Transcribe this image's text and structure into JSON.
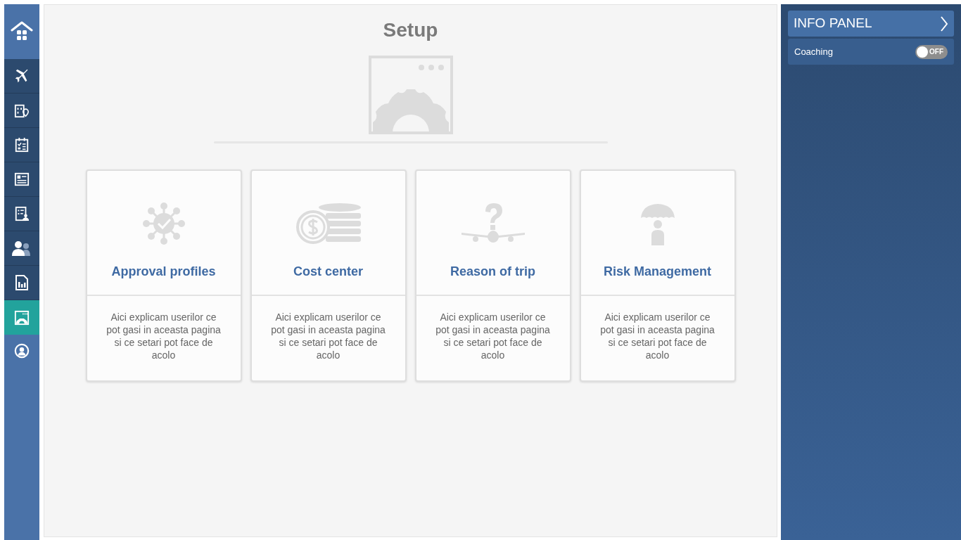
{
  "sidebar": {
    "items": [
      {
        "kind": "home",
        "selected": false
      },
      {
        "kind": "plane",
        "selected": false
      },
      {
        "kind": "hotel",
        "selected": false
      },
      {
        "kind": "checklist",
        "selected": false
      },
      {
        "kind": "news",
        "selected": false
      },
      {
        "kind": "report",
        "selected": false
      },
      {
        "kind": "users",
        "selected": false
      },
      {
        "kind": "chart",
        "selected": false
      },
      {
        "kind": "setup",
        "selected": true
      },
      {
        "kind": "profile",
        "selected": false
      }
    ]
  },
  "main": {
    "title": "Setup",
    "cards": [
      {
        "kind": "approval",
        "title": "Approval profiles",
        "description": "Aici explicam userilor ce pot gasi in aceasta pagina si ce setari pot face de acolo"
      },
      {
        "kind": "cost",
        "title": "Cost center",
        "description": "Aici explicam userilor ce pot gasi in aceasta pagina si ce setari pot face de acolo"
      },
      {
        "kind": "trip",
        "title": "Reason of trip",
        "description": "Aici explicam userilor ce pot gasi in aceasta pagina si ce setari pot face de acolo"
      },
      {
        "kind": "risk",
        "title": "Risk Management",
        "description": "Aici explicam userilor ce pot gasi in aceasta pagina si ce setari pot face de acolo"
      }
    ]
  },
  "info_panel": {
    "title": "INFO PANEL",
    "coaching": {
      "label": "Coaching",
      "on": false,
      "state_label": "OFF"
    }
  }
}
